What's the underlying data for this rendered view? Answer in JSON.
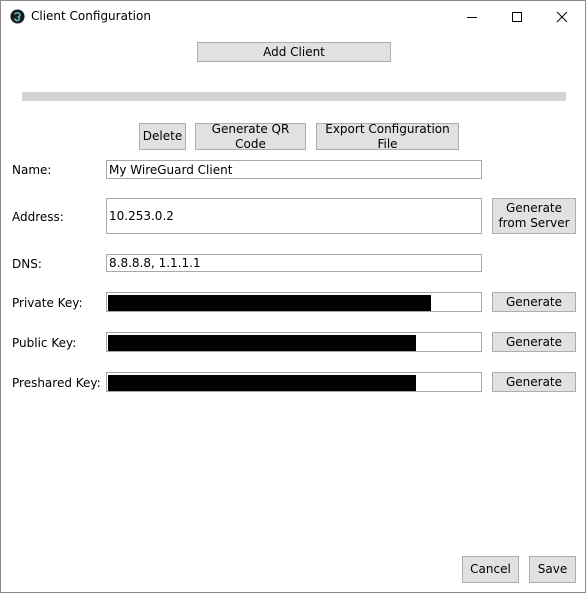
{
  "window": {
    "title": "Client Configuration",
    "app_icon": "wireguard-icon",
    "controls": [
      "minimize-icon",
      "maximize-icon",
      "close-icon"
    ]
  },
  "toolbar": {
    "add_client_label": "Add Client",
    "delete_label": "Delete",
    "qr_label": "Generate QR Code",
    "export_label": "Export Configuration File"
  },
  "form": {
    "name": {
      "label": "Name:",
      "value": "My WireGuard Client"
    },
    "address": {
      "label": "Address:",
      "value": "10.253.0.2",
      "generate_label": "Generate from Server"
    },
    "dns": {
      "label": "DNS:",
      "value": "8.8.8.8, 1.1.1.1"
    },
    "private_key": {
      "label": "Private Key:",
      "generate_label": "Generate"
    },
    "public_key": {
      "label": "Public Key:",
      "generate_label": "Generate"
    },
    "preshared_key": {
      "label": "Preshared Key:",
      "generate_label": "Generate"
    }
  },
  "footer": {
    "cancel_label": "Cancel",
    "save_label": "Save"
  },
  "colors": {
    "button_bg": "#e1e1e1",
    "button_border": "#adadad",
    "divider": "#d3d3d3",
    "redaction": "#000000"
  }
}
